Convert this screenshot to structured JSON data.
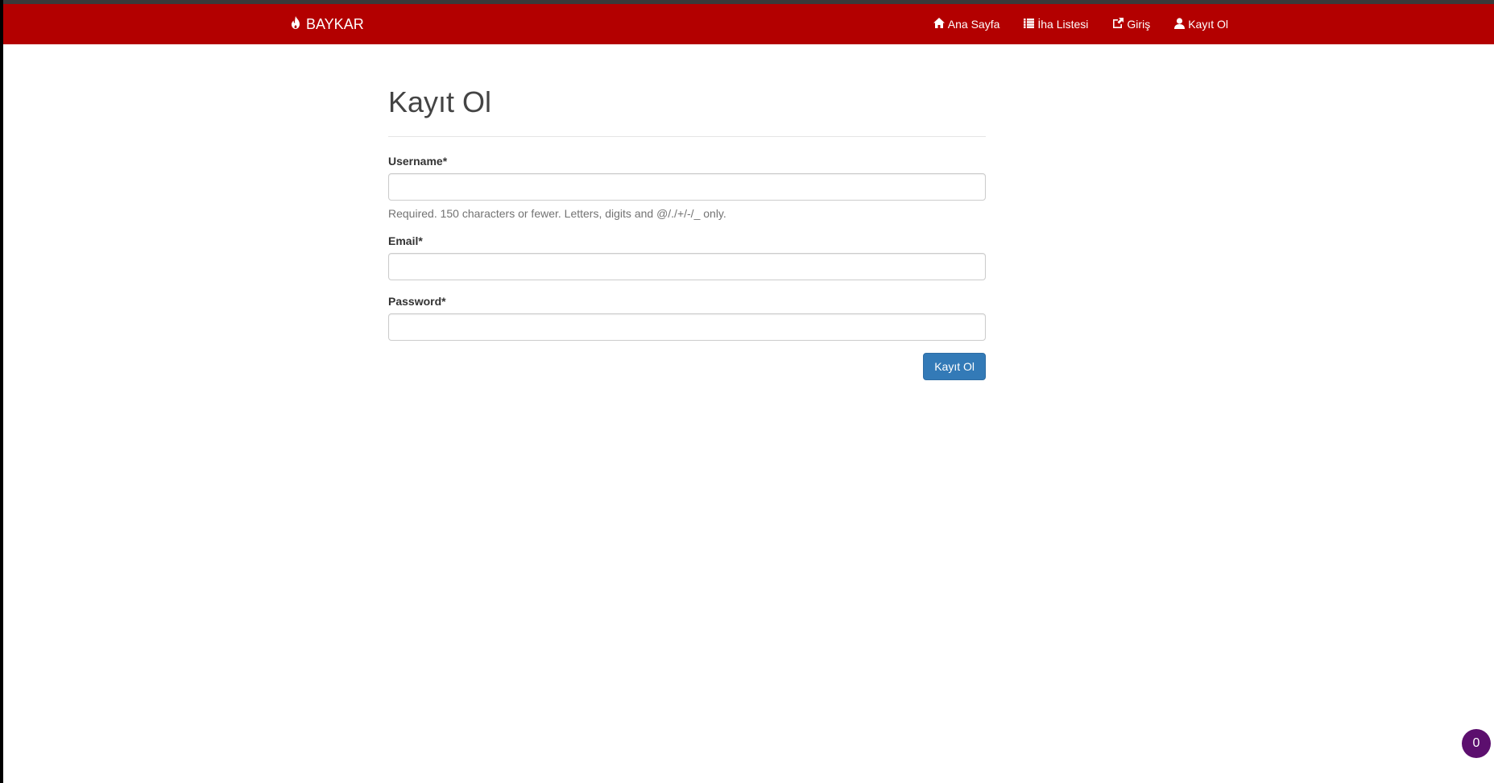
{
  "navbar": {
    "brand": "BAYKAR",
    "brand_icon": "fire-icon",
    "background": "#b30000",
    "items": [
      {
        "label": "Ana Sayfa",
        "icon": "home-icon"
      },
      {
        "label": "İha Listesi",
        "icon": "list-icon"
      },
      {
        "label": "Giriş",
        "icon": "login-icon"
      },
      {
        "label": "Kayıt Ol",
        "icon": "user-icon"
      }
    ]
  },
  "form": {
    "title": "Kayıt Ol",
    "username": {
      "label": "Username*",
      "value": "",
      "help": "Required. 150 characters or fewer. Letters, digits and @/./+/-/_ only."
    },
    "email": {
      "label": "Email*",
      "value": ""
    },
    "password": {
      "label": "Password*",
      "value": ""
    },
    "submit_label": "Kayıt Ol",
    "button_color": "#337ab7"
  },
  "floating_badge": {
    "count": "0",
    "color": "#5c0f6e"
  }
}
